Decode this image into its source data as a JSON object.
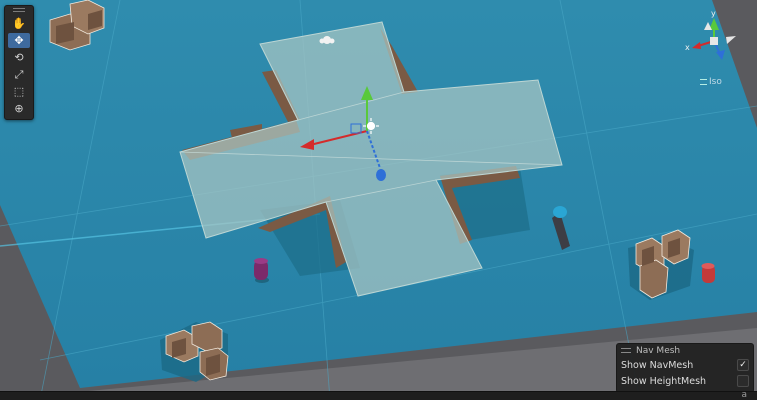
{
  "toolbar": {
    "tools": [
      {
        "name": "hand-tool-icon",
        "glyph": "✋",
        "active": false
      },
      {
        "name": "move-tool-icon",
        "glyph": "✥",
        "active": true
      },
      {
        "name": "rotate-tool-icon",
        "glyph": "⟲",
        "active": false
      },
      {
        "name": "scale-tool-icon",
        "glyph": "⤢",
        "active": false
      },
      {
        "name": "rect-tool-icon",
        "glyph": "⬚",
        "active": false
      },
      {
        "name": "transform-tool-icon",
        "glyph": "⊕",
        "active": false
      }
    ]
  },
  "orientation_gizmo": {
    "projection_label": "Iso",
    "x_axis_label": "x",
    "y_axis_label": "y"
  },
  "navmesh_overlay": {
    "title": "Nav Mesh",
    "show_navmesh_label": "Show NavMesh",
    "show_navmesh_checked": true,
    "show_heightmesh_label": "Show HeightMesh",
    "show_heightmesh_checked": false
  },
  "status_bar": {
    "text": "a"
  },
  "colors": {
    "ground": "#2a87a8",
    "navmesh_overlay": "#a9c6c4",
    "wall_brown": "#7a5a44",
    "x_axis": "#d42b2b",
    "y_axis": "#59c93b",
    "z_axis": "#2e6fd8",
    "agent_purple": "#7b2a6a",
    "agent_red": "#c33a3a",
    "agent_blue": "#2aa6d4"
  }
}
